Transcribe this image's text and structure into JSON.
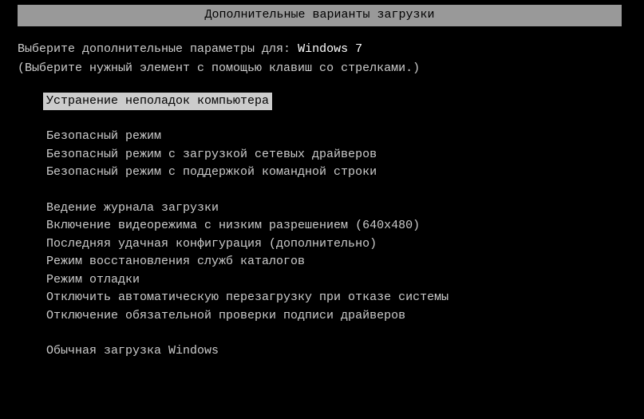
{
  "title": "Дополнительные варианты загрузки",
  "header": {
    "prompt_prefix": "Выберите дополнительные параметры для: ",
    "os_name": "Windows 7",
    "instruction": "(Выберите нужный элемент с помощью клавиш со стрелками.)"
  },
  "menu": {
    "groups": [
      {
        "items": [
          {
            "label": "Устранение неполадок компьютера",
            "selected": true
          }
        ]
      },
      {
        "items": [
          {
            "label": "Безопасный режим",
            "selected": false
          },
          {
            "label": "Безопасный режим с загрузкой сетевых драйверов",
            "selected": false
          },
          {
            "label": "Безопасный режим с поддержкой командной строки",
            "selected": false
          }
        ]
      },
      {
        "items": [
          {
            "label": "Ведение журнала загрузки",
            "selected": false
          },
          {
            "label": "Включение видеорежима с низким разрешением (640x480)",
            "selected": false
          },
          {
            "label": "Последняя удачная конфигурация (дополнительно)",
            "selected": false
          },
          {
            "label": "Режим восстановления служб каталогов",
            "selected": false
          },
          {
            "label": "Режим отладки",
            "selected": false
          },
          {
            "label": "Отключить автоматическую перезагрузку при отказе системы",
            "selected": false
          },
          {
            "label": "Отключение обязательной проверки подписи драйверов",
            "selected": false
          }
        ]
      },
      {
        "items": [
          {
            "label": "Обычная загрузка Windows",
            "selected": false
          }
        ]
      }
    ]
  }
}
